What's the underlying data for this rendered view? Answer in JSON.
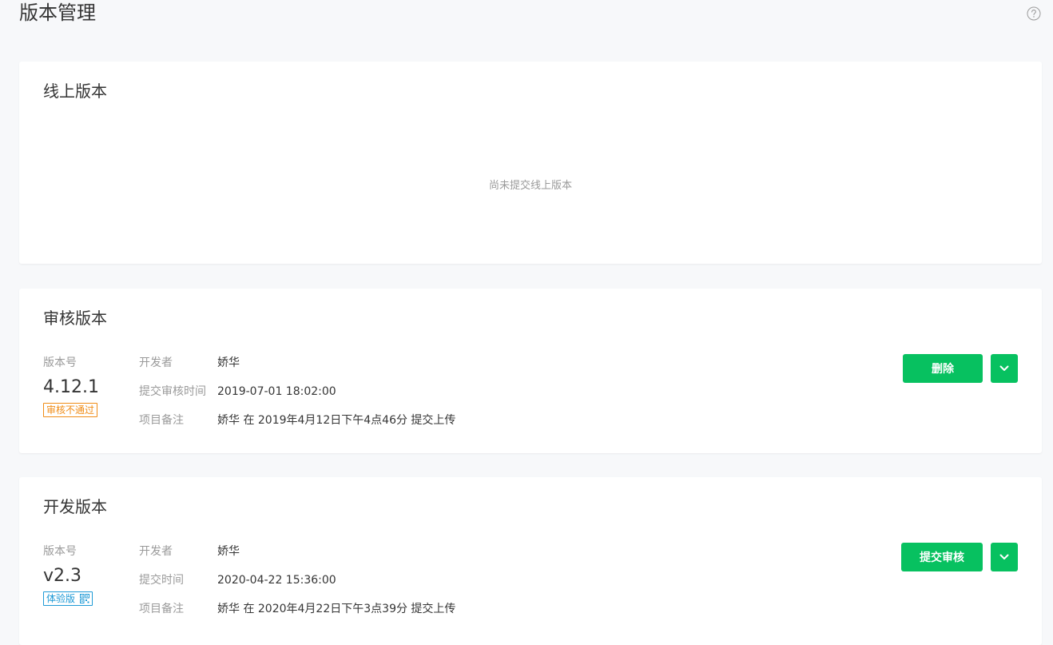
{
  "page": {
    "title": "版本管理",
    "help_icon": "question-circle-icon"
  },
  "online": {
    "title": "线上版本",
    "empty_tip": "尚未提交线上版本"
  },
  "review": {
    "title": "审核版本",
    "version_label": "版本号",
    "version_number": "4.12.1",
    "status_badge": "审核不通过",
    "rows": [
      {
        "key": "开发者",
        "value": "娇华"
      },
      {
        "key": "提交审核时间",
        "value": "2019-07-01 18:02:00"
      },
      {
        "key": "项目备注",
        "value": "娇华 在 2019年4月12日下午4点46分 提交上传"
      }
    ],
    "primary_button": "删除",
    "dropdown_icon": "chevron-down-icon"
  },
  "dev": {
    "title": "开发版本",
    "version_label": "版本号",
    "version_number": "v2.3",
    "status_badge": "体验版",
    "badge_icon": "qrcode-icon",
    "rows": [
      {
        "key": "开发者",
        "value": "娇华"
      },
      {
        "key": "提交时间",
        "value": "2020-04-22 15:36:00"
      },
      {
        "key": "项目备注",
        "value": "娇华 在 2020年4月22日下午3点39分 提交上传"
      }
    ],
    "primary_button": "提交审核",
    "dropdown_icon": "chevron-down-icon"
  },
  "colors": {
    "primary": "#07c160",
    "warning": "#f08c16",
    "link": "#1e9ad6",
    "background": "#f7f8fa"
  }
}
